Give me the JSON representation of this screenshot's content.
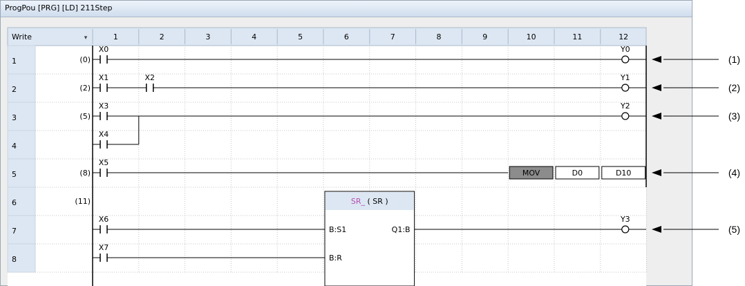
{
  "window": {
    "title": "ProgPou [PRG] [LD] 211Step"
  },
  "header": {
    "mode_label": "Write",
    "dropdown_glyph": "▾",
    "columns": [
      "1",
      "2",
      "3",
      "4",
      "5",
      "6",
      "7",
      "8",
      "9",
      "10",
      "11",
      "12"
    ]
  },
  "rows": [
    "1",
    "2",
    "3",
    "4",
    "5",
    "6",
    "7",
    "8"
  ],
  "steps": [
    {
      "row": 0,
      "label": "(0)"
    },
    {
      "row": 1,
      "label": "(2)"
    },
    {
      "row": 2,
      "label": "(5)"
    },
    {
      "row": 4,
      "label": "(8)"
    },
    {
      "row": 5,
      "label": "(11)"
    }
  ],
  "contacts": [
    {
      "row": 0,
      "col": 0,
      "label": "X0"
    },
    {
      "row": 1,
      "col": 0,
      "label": "X1"
    },
    {
      "row": 1,
      "col": 1,
      "label": "X2"
    },
    {
      "row": 2,
      "col": 0,
      "label": "X3"
    },
    {
      "row": 3,
      "col": 0,
      "label": "X4"
    },
    {
      "row": 4,
      "col": 0,
      "label": "X5"
    },
    {
      "row": 6,
      "col": 0,
      "label": "X6"
    },
    {
      "row": 7,
      "col": 0,
      "label": "X7"
    }
  ],
  "coils": [
    {
      "row": 0,
      "label": "Y0"
    },
    {
      "row": 1,
      "label": "Y1"
    },
    {
      "row": 2,
      "label": "Y2"
    },
    {
      "row": 6,
      "label": "Y3"
    }
  ],
  "instruction": {
    "row": 4,
    "name": "MOV",
    "operands": [
      "D0",
      "D10"
    ]
  },
  "function_block": {
    "title": "SR_",
    "type": "( SR )",
    "pins": {
      "s1": "B:S1",
      "q1": "Q1:B",
      "r": "B:R"
    }
  },
  "callouts": [
    {
      "row": 0,
      "label": "(1)"
    },
    {
      "row": 1,
      "label": "(2)"
    },
    {
      "row": 2,
      "label": "(3)"
    },
    {
      "row": 4,
      "label": "(4)"
    },
    {
      "row": 6,
      "label": "(5)"
    }
  ],
  "colors": {
    "header_bg": "#dde7f3",
    "grid": "#c4c4c4",
    "line": "#000000",
    "mov_bg": "#8c8c8c",
    "fb_header": "#dde7f3",
    "fb_title": "#b04fb0",
    "canvas_bg": "#ffffff"
  }
}
